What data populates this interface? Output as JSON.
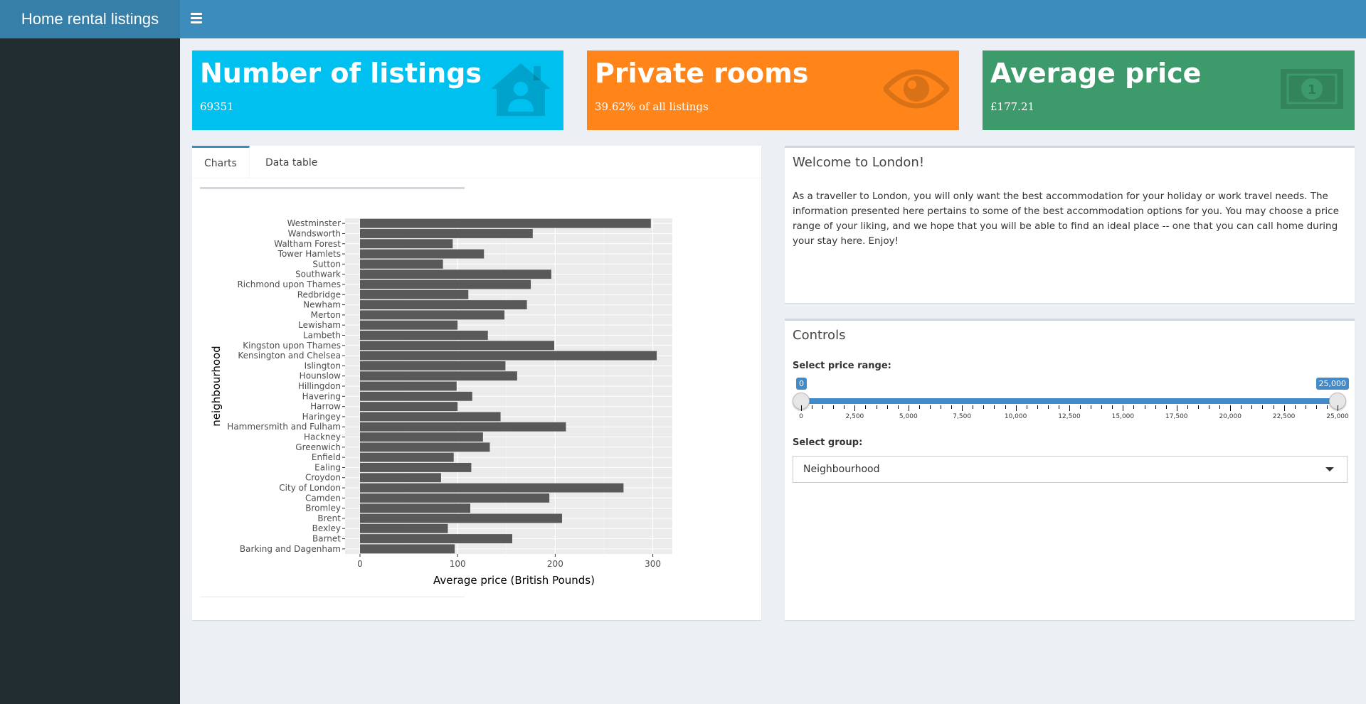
{
  "header": {
    "app_title": "Home rental listings",
    "menu_icon": "hamburger-icon"
  },
  "value_boxes": [
    {
      "title": "Number of listings",
      "value": "69351",
      "icon": "house-user-icon",
      "color": "#00c0ef"
    },
    {
      "title": "Private rooms",
      "value": "39.62% of all listings",
      "icon": "eye-icon",
      "color": "#ff851b"
    },
    {
      "title": "Average price",
      "value": "£177.21",
      "icon": "money-bill-icon",
      "color": "#3c9a6b"
    }
  ],
  "tabs": [
    {
      "label": "Charts",
      "active": true
    },
    {
      "label": "Data table",
      "active": false
    }
  ],
  "welcome": {
    "title": "Welcome to London!",
    "text": "As a traveller to London, you will only want the best accommodation for your holiday or work travel needs. The information presented here pertains to some of the best accommodation options for you. You may choose a price range of your liking, and we hope that you will be able to find an ideal place -- one that you can call home during your stay here. Enjoy!"
  },
  "controls": {
    "title": "Controls",
    "price_label": "Select price range:",
    "price_min": "0",
    "price_max": "25,000",
    "tick_labels": [
      "0",
      "2,500",
      "5,000",
      "7,500",
      "10,000",
      "12,500",
      "15,000",
      "17,500",
      "20,000",
      "22,500",
      "25,000"
    ],
    "group_label": "Select group:",
    "group_value": "Neighbourhood"
  },
  "chart_data": {
    "type": "bar",
    "orientation": "horizontal",
    "xlabel": "Average price (British Pounds)",
    "ylabel": "neighbourhood",
    "xlim": [
      0,
      320
    ],
    "x_ticks": [
      0,
      100,
      200,
      300
    ],
    "grid": true,
    "categories": [
      "Westminster",
      "Wandsworth",
      "Waltham Forest",
      "Tower Hamlets",
      "Sutton",
      "Southwark",
      "Richmond upon Thames",
      "Redbridge",
      "Newham",
      "Merton",
      "Lewisham",
      "Lambeth",
      "Kingston upon Thames",
      "Kensington and Chelsea",
      "Islington",
      "Hounslow",
      "Hillingdon",
      "Havering",
      "Harrow",
      "Haringey",
      "Hammersmith and Fulham",
      "Hackney",
      "Greenwich",
      "Enfield",
      "Ealing",
      "Croydon",
      "City of London",
      "Camden",
      "Bromley",
      "Brent",
      "Bexley",
      "Barnet",
      "Barking and Dagenham"
    ],
    "values": [
      298,
      177,
      95,
      127,
      85,
      196,
      175,
      111,
      171,
      148,
      100,
      131,
      199,
      304,
      149,
      161,
      99,
      115,
      100,
      144,
      211,
      126,
      133,
      96,
      114,
      83,
      270,
      194,
      113,
      207,
      90,
      156,
      97
    ]
  }
}
